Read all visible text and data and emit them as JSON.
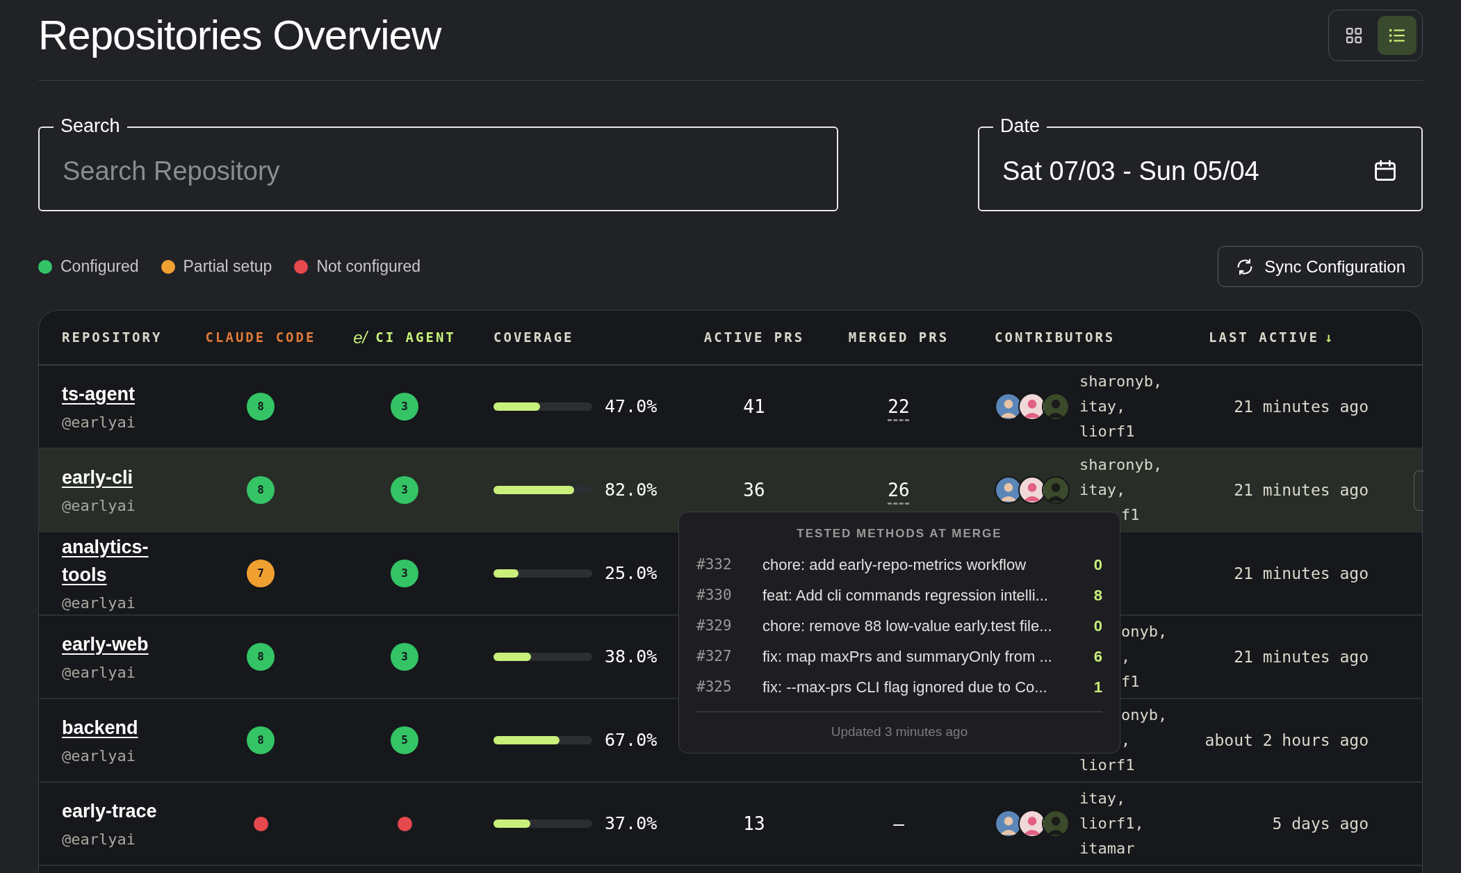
{
  "title": "Repositories Overview",
  "view_toggle": [
    {
      "kind": "grid",
      "selected": false
    },
    {
      "kind": "list",
      "selected": true
    }
  ],
  "search": {
    "label": "Search",
    "placeholder": "Search Repository"
  },
  "date": {
    "label": "Date",
    "value": "Sat 07/03 - Sun 05/04"
  },
  "legend": [
    {
      "label": "Configured",
      "color": "#34c466"
    },
    {
      "label": "Partial setup",
      "color": "#f0a030"
    },
    {
      "label": "Not configured",
      "color": "#e5484d"
    }
  ],
  "sync_button": "Sync Configuration",
  "table": {
    "columns": [
      {
        "label": "REPOSITORY",
        "kind": "plain"
      },
      {
        "label": "CLAUDE CODE",
        "kind": "claude"
      },
      {
        "label": "CI AGENT",
        "kind": "ci",
        "logo": "e/"
      },
      {
        "label": "COVERAGE",
        "kind": "plain"
      },
      {
        "label": "ACTIVE PRS",
        "kind": "plain"
      },
      {
        "label": "MERGED PRS",
        "kind": "plain"
      },
      {
        "label": "CONTRIBUTORS",
        "kind": "plain"
      },
      {
        "label": "LAST ACTIVE",
        "kind": "sorted",
        "sort_icon": "↓"
      }
    ],
    "rows": [
      {
        "name": "ts-agent",
        "link": true,
        "owner": "@earlyai",
        "selected": false,
        "claude_code": {
          "kind": "badge",
          "value": "8",
          "color": "#34c466"
        },
        "ci_agent": {
          "kind": "badge",
          "value": "3",
          "color": "#34c466"
        },
        "coverage": {
          "level": 0.47,
          "reading": "47.0%"
        },
        "active_prs": "41",
        "merged_prs": {
          "value": "22",
          "details": true
        },
        "contributors": [
          {
            "text": "sharonyb,",
            "kind": "name"
          },
          {
            "text": "itay,",
            "kind": "name"
          },
          {
            "text": "liorf1",
            "kind": "name"
          }
        ],
        "last_active": "21 minutes ago"
      },
      {
        "name": "early-cli",
        "link": true,
        "owner": "@earlyai",
        "selected": true,
        "claude_code": {
          "kind": "badge",
          "value": "8",
          "color": "#34c466"
        },
        "ci_agent": {
          "kind": "badge",
          "value": "3",
          "color": "#34c466"
        },
        "coverage": {
          "level": 0.82,
          "reading": "82.0%"
        },
        "active_prs": "36",
        "merged_prs": {
          "value": "26",
          "details": true
        },
        "contributors": [
          {
            "text": "sharonyb,",
            "kind": "name"
          },
          {
            "text": "itay,",
            "kind": "name"
          },
          {
            "text": "f1",
            "kind": "fragment"
          }
        ],
        "last_active": "21 minutes ago"
      },
      {
        "name": "analytics-tools",
        "link": true,
        "owner": "@earlyai",
        "selected": false,
        "claude_code": {
          "kind": "badge",
          "value": "7",
          "color": "#f0a030"
        },
        "ci_agent": {
          "kind": "badge",
          "value": "3",
          "color": "#34c466"
        },
        "coverage": {
          "level": 0.25,
          "reading": "25.0%"
        },
        "last_active": "21 minutes ago"
      },
      {
        "name": "early-web",
        "link": true,
        "owner": "@earlyai",
        "selected": false,
        "claude_code": {
          "kind": "badge",
          "value": "8",
          "color": "#34c466"
        },
        "ci_agent": {
          "kind": "badge",
          "value": "3",
          "color": "#34c466"
        },
        "coverage": {
          "level": 0.38,
          "reading": "38.0%"
        },
        "contributors": [
          {
            "text": "onyb,",
            "kind": "fragment"
          },
          {
            "text": ",",
            "kind": "fragment"
          },
          {
            "text": "f1",
            "kind": "fragment"
          }
        ],
        "last_active": "21 minutes ago"
      },
      {
        "name": "backend",
        "link": true,
        "owner": "@earlyai",
        "selected": false,
        "claude_code": {
          "kind": "badge",
          "value": "8",
          "color": "#34c466"
        },
        "ci_agent": {
          "kind": "badge",
          "value": "5",
          "color": "#34c466"
        },
        "coverage": {
          "level": 0.67,
          "reading": "67.0%"
        },
        "contributors": [
          {
            "text": "onyb,",
            "kind": "fragment"
          },
          {
            "text": ",",
            "kind": "fragment"
          },
          {
            "text": "liorf1",
            "kind": "name"
          }
        ],
        "last_active": "about 2 hours ago"
      },
      {
        "name": "early-trace",
        "link": false,
        "owner": "@earlyai",
        "selected": false,
        "claude_code": {
          "kind": "dot",
          "color": "#e5484d"
        },
        "ci_agent": {
          "kind": "dot",
          "color": "#e5484d"
        },
        "coverage": {
          "level": 0.37,
          "reading": "37.0%"
        },
        "active_prs": "13",
        "merged_prs": {
          "value": "–",
          "details": false
        },
        "contributors": [
          {
            "text": "itay,",
            "kind": "name"
          },
          {
            "text": "liorf1,",
            "kind": "name"
          },
          {
            "text": "itamar",
            "kind": "name"
          }
        ],
        "last_active": "5 days ago"
      }
    ]
  },
  "tooltip": {
    "title": "TESTED METHODS AT MERGE",
    "rows": [
      {
        "pr": "#332",
        "title": "chore: add early-repo-metrics workflow",
        "count": "0"
      },
      {
        "pr": "#330",
        "title": "feat: Add cli commands regression intelli...",
        "count": "8"
      },
      {
        "pr": "#329",
        "title": "chore: remove 88 low-value early.test file...",
        "count": "0"
      },
      {
        "pr": "#327",
        "title": "fix: map maxPrs and summaryOnly from ...",
        "count": "6"
      },
      {
        "pr": "#325",
        "title": "fix: --max-prs CLI flag ignored due to Co...",
        "count": "1"
      }
    ],
    "footer": "Updated 3 minutes ago"
  }
}
